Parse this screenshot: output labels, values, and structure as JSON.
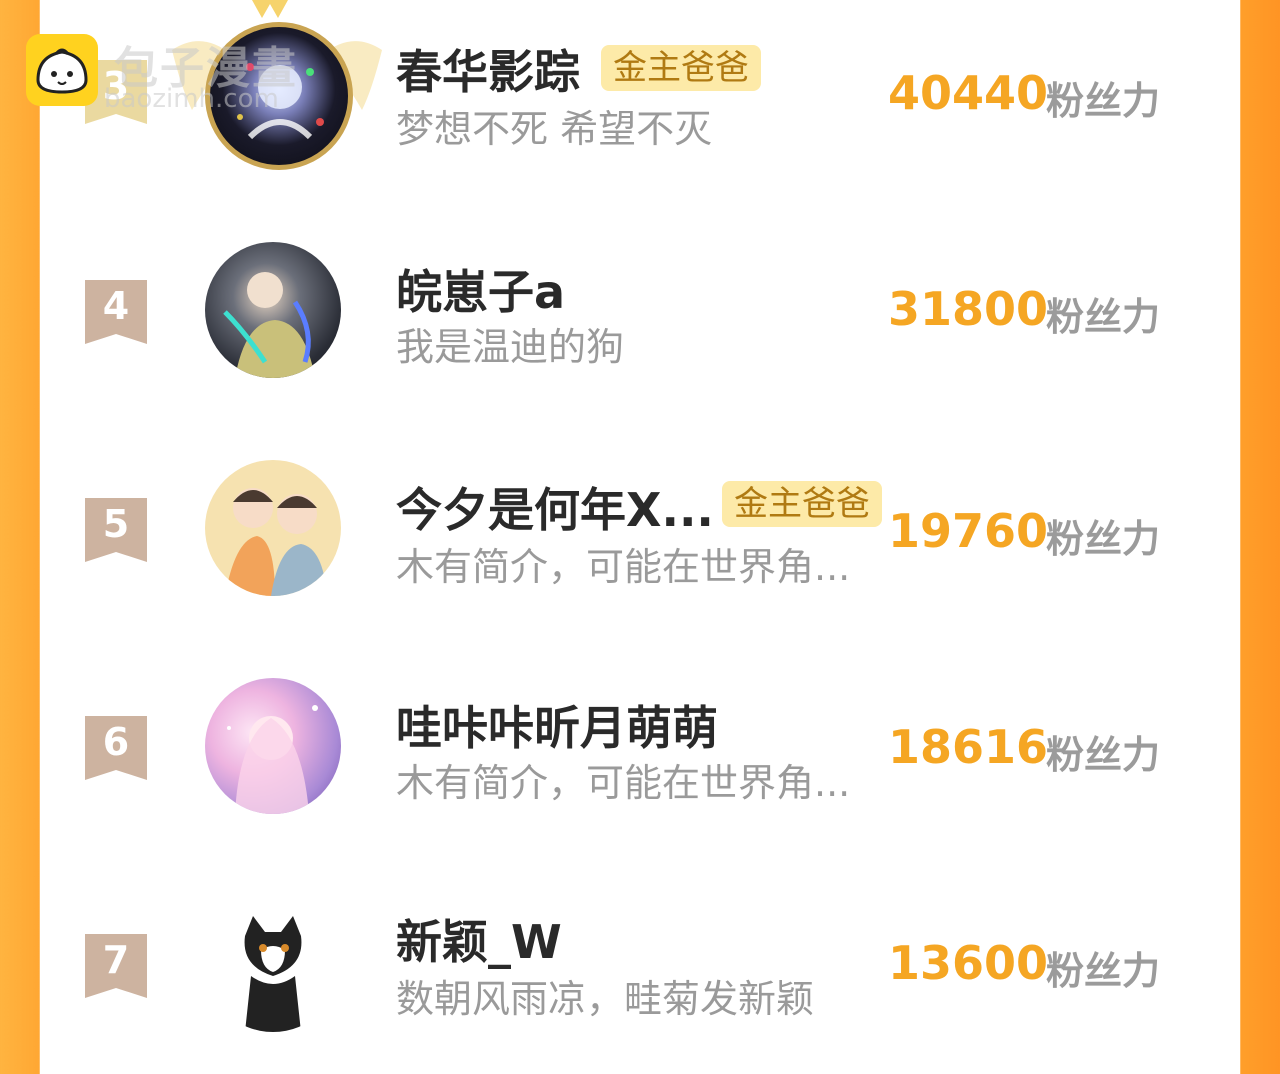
{
  "watermark": {
    "cn": "包子漫畫",
    "en": "baozimh.com"
  },
  "rows": [
    {
      "rank": "3",
      "name": "春华影踪",
      "badge": "金主爸爸",
      "bio": "梦想不死 希望不灭",
      "fans": "40440",
      "unit": "粉丝力"
    },
    {
      "rank": "4",
      "name": "皖崽子a",
      "badge": "",
      "bio": "我是温迪的狗",
      "fans": "31800",
      "unit": "粉丝力"
    },
    {
      "rank": "5",
      "name": "今夕是何年X...",
      "badge": "金主爸爸",
      "bio": "木有简介，可能在世界角...",
      "fans": "19760",
      "unit": "粉丝力"
    },
    {
      "rank": "6",
      "name": "哇咔咔昕月萌萌",
      "badge": "",
      "bio": "木有简介，可能在世界角...",
      "fans": "18616",
      "unit": "粉丝力"
    },
    {
      "rank": "7",
      "name": "新颖_W",
      "badge": "",
      "bio": "数朝风雨凉，畦菊发新颖",
      "fans": "13600",
      "unit": "粉丝力"
    }
  ]
}
